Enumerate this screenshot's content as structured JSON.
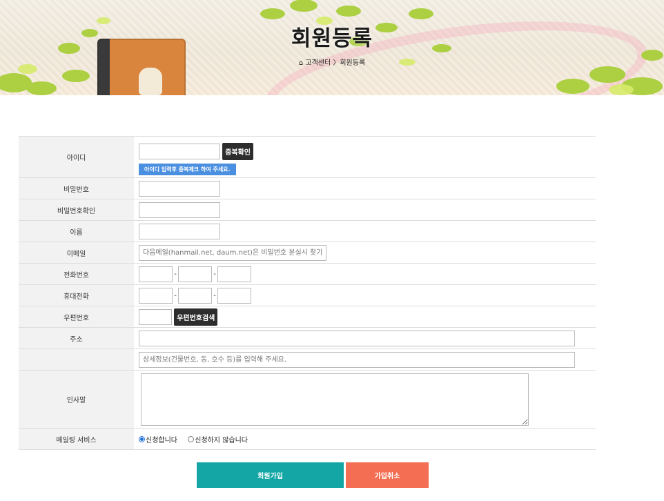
{
  "banner": {
    "title": "회원등록",
    "breadcrumb": "고객센터 〉회원등록",
    "home_icon": "home-icon"
  },
  "form": {
    "rows": {
      "id": {
        "label": "아이디",
        "value": "",
        "check_button": "중복확인",
        "hint": "아이디 입력후 중복체크 하여 주세요."
      },
      "password": {
        "label": "비밀번호",
        "value": ""
      },
      "password_confirm": {
        "label": "비밀번호확인",
        "value": ""
      },
      "name": {
        "label": "이름",
        "value": ""
      },
      "email": {
        "label": "이메일",
        "value": "",
        "placeholder": "다음메일(hanmail.net, daum.net)은 비밀번호 분실시 찾기 어려워요"
      },
      "phone": {
        "label": "전화번호",
        "part1": "",
        "part2": "",
        "part3": "",
        "separator": "-"
      },
      "mobile": {
        "label": "휴대전화",
        "part1": "",
        "part2": "",
        "part3": "",
        "separator": "-"
      },
      "zipcode": {
        "label": "우편번호",
        "value": "",
        "search_button": "우편번호검색"
      },
      "address": {
        "label": "주소",
        "value": "",
        "detail_placeholder": "상세정보(건물번호, 동, 호수 등)를 입력해 주세요."
      },
      "greeting": {
        "label": "인사말",
        "value": ""
      },
      "mailing": {
        "label": "메일링 서비스",
        "options": [
          "신청합니다",
          "신청하지 않습니다"
        ],
        "selected": "신청합니다"
      }
    }
  },
  "actions": {
    "join": "회원가입",
    "cancel": "가입취소"
  },
  "colors": {
    "join": "#13a6a4",
    "cancel": "#f46e53",
    "hint": "#4a8fe0",
    "label_bg": "#f2f2f2"
  }
}
